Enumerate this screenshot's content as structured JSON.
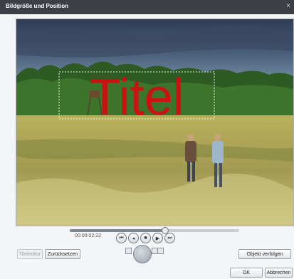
{
  "window": {
    "title": "Bildgröße und Position",
    "close_glyph": "×"
  },
  "preview": {
    "overlay_title": "Titel",
    "overlay_color": "#cc1111"
  },
  "timeline": {
    "timecode": "00:00:02:22",
    "position_fraction": 0.56
  },
  "transport": {
    "buttons": [
      {
        "name": "skip-start-icon",
        "glyph": "⏮"
      },
      {
        "name": "step-back-icon",
        "glyph": "◂"
      },
      {
        "name": "stop-icon",
        "glyph": "■"
      },
      {
        "name": "play-icon",
        "glyph": "▶"
      },
      {
        "name": "skip-end-icon",
        "glyph": "⏭"
      }
    ]
  },
  "buttons": {
    "titleeditor": "Titeleditor",
    "reset": "Zurücksetzen",
    "track_object": "Objekt verfolgen",
    "ok": "OK",
    "cancel": "Abbrechen"
  }
}
